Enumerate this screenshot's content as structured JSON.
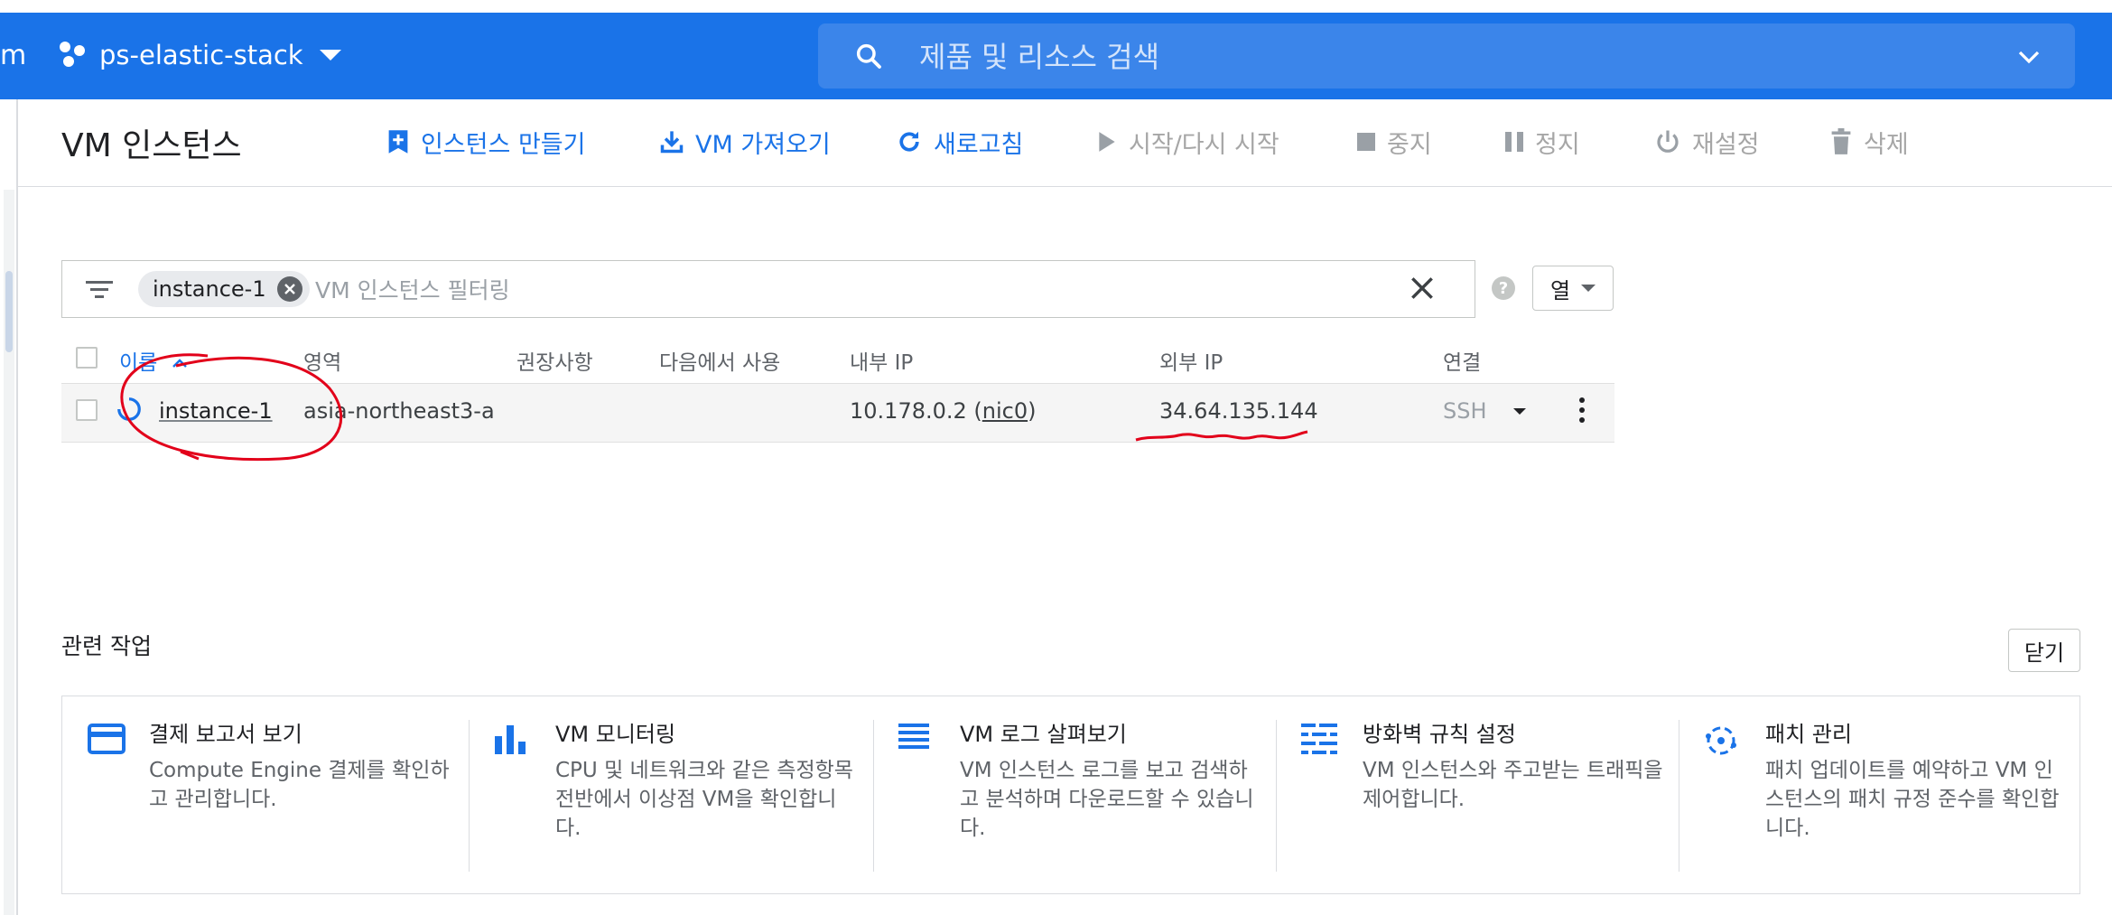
{
  "topbar": {
    "brand_fragment": "m",
    "project_name": "ps-elastic-stack",
    "search_placeholder": "제품 및 리소스 검색"
  },
  "toolbar": {
    "page_title": "VM 인스턴스",
    "create_label": "인스턴스 만들기",
    "import_label": "VM 가져오기",
    "refresh_label": "새로고침",
    "start_label": "시작/다시 시작",
    "stop_label": "중지",
    "suspend_label": "정지",
    "reset_label": "재설정",
    "delete_label": "삭제"
  },
  "filter": {
    "chip_label": "instance-1",
    "placeholder": "VM 인스턴스 필터링",
    "help": "?",
    "columns_label": "열"
  },
  "table": {
    "headers": {
      "name": "이름",
      "zone": "영역",
      "recommendation": "권장사항",
      "in_use_by": "다음에서 사용",
      "internal_ip": "내부 IP",
      "external_ip": "외부 IP",
      "connect": "연결"
    },
    "rows": [
      {
        "name": "instance-1",
        "zone": "asia-northeast3-a",
        "internal_ip_prefix": "10.178.0.2 (",
        "nic": "nic0",
        "internal_ip_suffix": ")",
        "external_ip": "34.64.135.144",
        "connect": "SSH"
      }
    ]
  },
  "related": {
    "title": "관련 작업",
    "close_label": "닫기",
    "cards": [
      {
        "title": "결제 보고서 보기",
        "desc": "Compute Engine 결제를 확인하고 관리합니다.",
        "icon": "credit-card-icon"
      },
      {
        "title": "VM 모니터링",
        "desc": "CPU 및 네트워크와 같은 측정항목 전반에서 이상점 VM을 확인합니다.",
        "icon": "bar-chart-icon"
      },
      {
        "title": "VM 로그 살펴보기",
        "desc": "VM 인스턴스 로그를 보고 검색하고 분석하며 다운로드할 수 있습니다.",
        "icon": "logs-icon"
      },
      {
        "title": "방화벽 규칙 설정",
        "desc": "VM 인스턴스와 주고받는 트래픽을 제어합니다.",
        "icon": "firewall-icon"
      },
      {
        "title": "패치 관리",
        "desc": "패치 업데이트를 예약하고 VM 인스턴스의 패치 규정 준수를 확인합니다.",
        "icon": "patch-icon"
      }
    ]
  },
  "colors": {
    "brand_blue": "#1a73e8",
    "annotation_red": "#e2001a"
  }
}
